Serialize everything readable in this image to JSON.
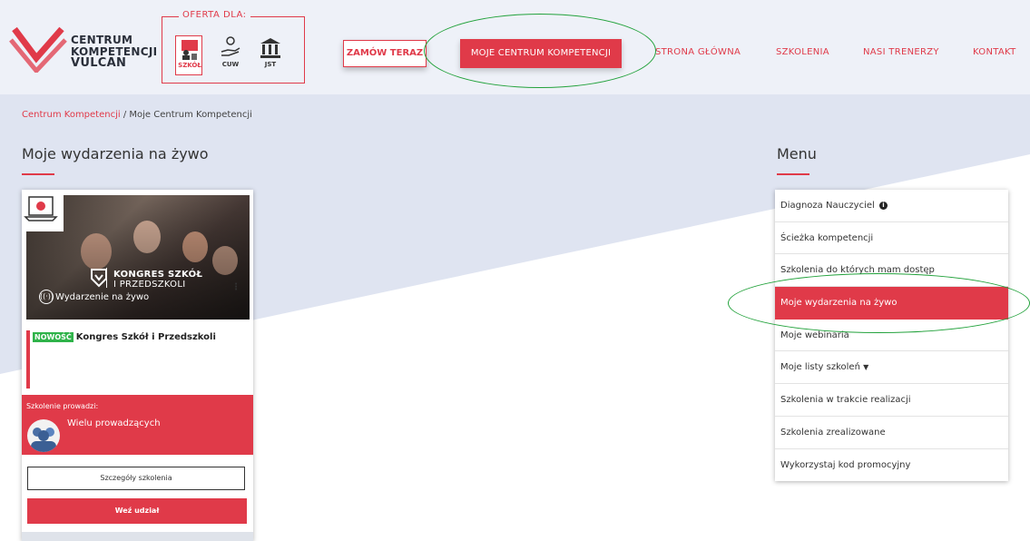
{
  "header": {
    "logo": {
      "line1": "CENTRUM",
      "line2": "KOMPETENCJI",
      "line3": "VULCAN"
    },
    "offer": {
      "title": "OFERTA DLA:",
      "items": [
        {
          "label": "SZKÓŁ",
          "active": true
        },
        {
          "label": "CUW",
          "active": false
        },
        {
          "label": "JST",
          "active": false
        }
      ]
    },
    "order_button": "ZAMÓW TERAZ",
    "my_center_button": "MOJE CENTRUM KOMPETENCJI",
    "nav": [
      {
        "label": "STRONA GŁÓWNA"
      },
      {
        "label": "SZKOLENIA"
      },
      {
        "label": "NASI TRENERZY"
      },
      {
        "label": "KONTAKT"
      }
    ]
  },
  "breadcrumb": {
    "root": "Centrum Kompetencji",
    "separator": " / ",
    "current": "Moje Centrum Kompetencji"
  },
  "main": {
    "title": "Moje wydarzenia na żywo",
    "card": {
      "image": {
        "logo_line1": "KONGRES SZKÓŁ",
        "logo_line2": "I PRZEDSZKOLI",
        "live_label": "Wydarzenie na żywo"
      },
      "badge": "NOWOŚĆ",
      "title": "Kongres Szkół i Przedszkoli",
      "lead_label": "Szkolenie prowadzi:",
      "lead_name": "Wielu prowadzących",
      "details_button": "Szczegóły szkolenia",
      "kebab": "⋮",
      "join_button": "Weź udział"
    }
  },
  "menu": {
    "title": "Menu",
    "items": [
      {
        "label": "Diagnoza Nauczyciel",
        "active": false
      },
      {
        "label": "Ścieżka kompetencji",
        "active": false
      },
      {
        "label": "Szkolenia do których mam dostęp",
        "active": false
      },
      {
        "label": "Moje wydarzenia na żywo",
        "active": true
      },
      {
        "label": "Moje webinaria",
        "active": false
      },
      {
        "label": "Moje listy szkoleń",
        "active": false
      },
      {
        "label": "Szkolenia w trakcie realizacji",
        "active": false
      },
      {
        "label": "Szkolenia zrealizowane",
        "active": false
      },
      {
        "label": "Wykorzystaj kod promocyjny",
        "active": false
      }
    ]
  },
  "colors": {
    "accent": "#e03a49",
    "highlight": "#23a23c",
    "header_bg": "#eef1f8",
    "band": "#dfe4f1"
  }
}
